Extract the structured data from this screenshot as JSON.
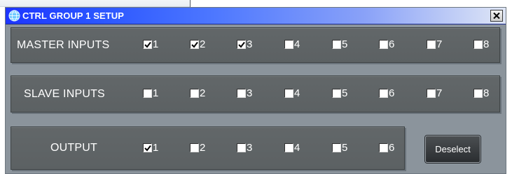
{
  "window": {
    "title": "CTRL GROUP 1 SETUP",
    "icon": "globe-app-icon",
    "close_icon": "close-x-icon"
  },
  "rows": [
    {
      "label": "MASTER INPUTS",
      "options": [
        {
          "label": "1",
          "checked": true
        },
        {
          "label": "2",
          "checked": true
        },
        {
          "label": "3",
          "checked": true
        },
        {
          "label": "4",
          "checked": false
        },
        {
          "label": "5",
          "checked": false
        },
        {
          "label": "6",
          "checked": false
        },
        {
          "label": "7",
          "checked": false
        },
        {
          "label": "8",
          "checked": false
        }
      ]
    },
    {
      "label": "SLAVE INPUTS",
      "options": [
        {
          "label": "1",
          "checked": false
        },
        {
          "label": "2",
          "checked": false
        },
        {
          "label": "3",
          "checked": false
        },
        {
          "label": "4",
          "checked": false
        },
        {
          "label": "5",
          "checked": false
        },
        {
          "label": "6",
          "checked": false
        },
        {
          "label": "7",
          "checked": false
        },
        {
          "label": "8",
          "checked": false
        }
      ]
    },
    {
      "label": "OUTPUT",
      "options": [
        {
          "label": "1",
          "checked": true
        },
        {
          "label": "2",
          "checked": false
        },
        {
          "label": "3",
          "checked": false
        },
        {
          "label": "4",
          "checked": false
        },
        {
          "label": "5",
          "checked": false
        },
        {
          "label": "6",
          "checked": false
        }
      ]
    }
  ],
  "deselect_label": "Deselect",
  "colors": {
    "panel": "#5f6466",
    "window_bg": "#8b949c",
    "title_start": "#1d35ff",
    "title_end": "#dfe6f5",
    "text": "#ffffff"
  }
}
